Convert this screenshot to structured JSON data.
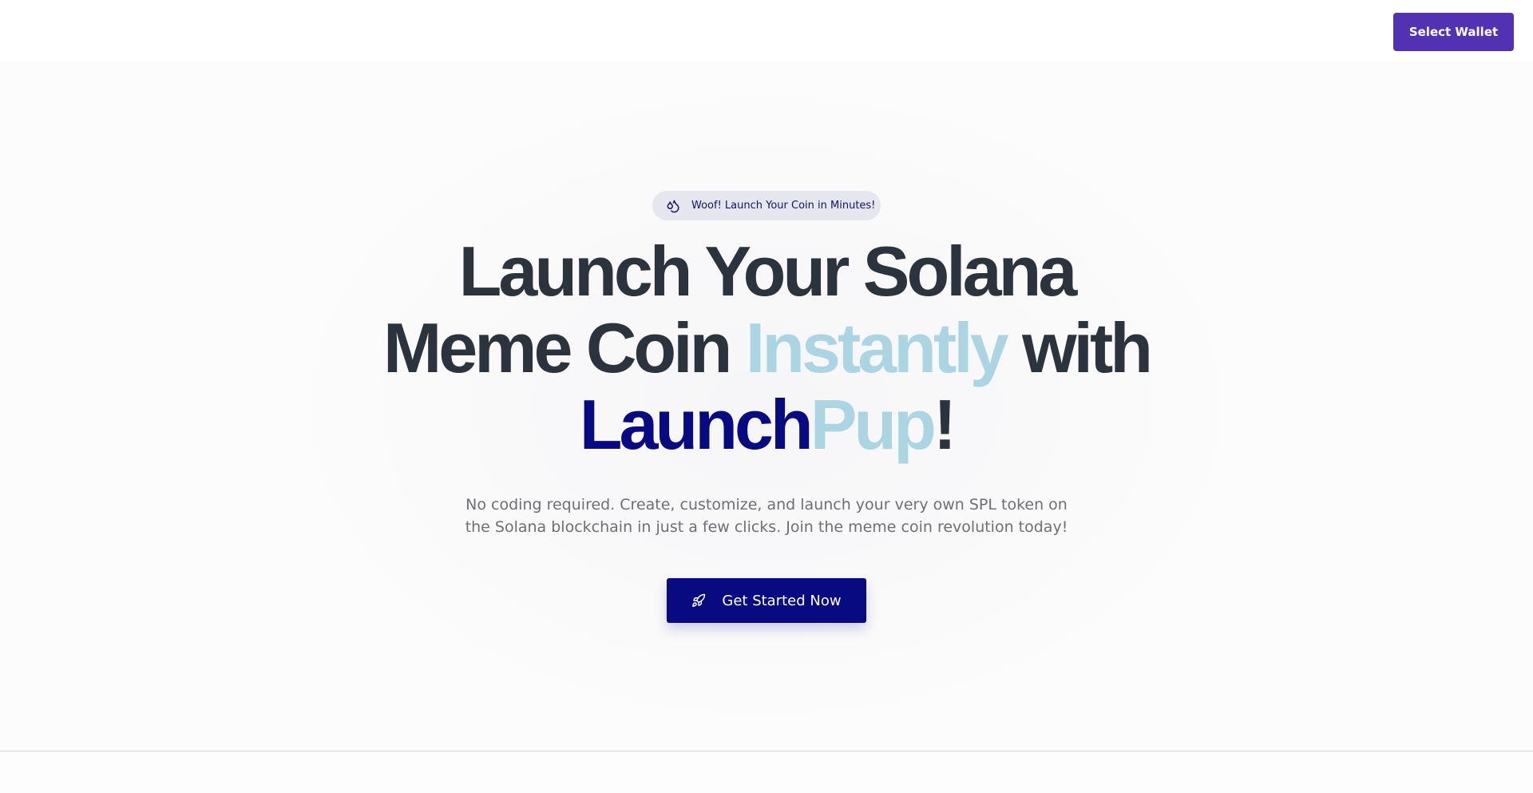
{
  "header": {
    "wallet_button_label": "Select Wallet"
  },
  "hero": {
    "badge": {
      "icon": "droplets-icon",
      "text": "Woof! Launch Your Coin in Minutes!"
    },
    "headline": {
      "line1": "Launch Your Solana",
      "line2_part1": "Meme Coin ",
      "line2_highlight": "Instantly",
      "line2_part2": " with",
      "brand_part1": "Launch",
      "brand_part2": "Pup",
      "brand_suffix": "!"
    },
    "subtitle": {
      "line1": "No coding required. Create, customize, and launch your very own SPL token on",
      "line2": "the Solana blockchain in just a few clicks. Join the meme coin revolution today!"
    },
    "cta": {
      "icon": "rocket-icon",
      "label": "Get Started Now"
    }
  },
  "colors": {
    "wallet_button": "#5331b3",
    "brand_dark": "#070a80",
    "brand_light": "#acd5e3",
    "headline_text": "#2b333c",
    "body_text": "#6d6f74",
    "badge_bg": "#e5e6ee"
  }
}
